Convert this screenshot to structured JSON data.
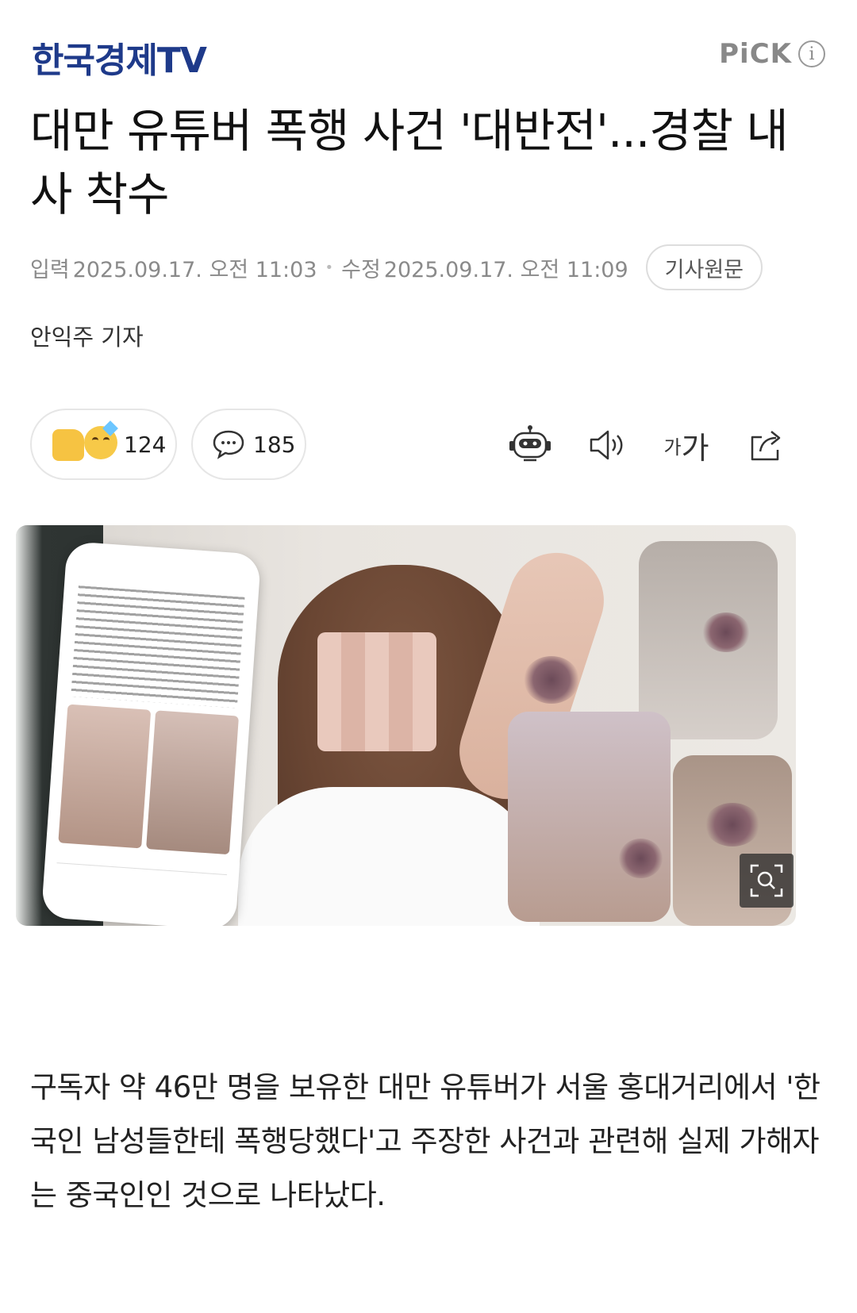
{
  "header": {
    "brand": "한국경제TV",
    "pick_label": "PiCK",
    "info_icon": "i"
  },
  "article": {
    "headline": "대만 유튜버 폭행 사건 '대반전'...경찰 내사 착수",
    "input_label": "입력",
    "input_time": "2025.09.17. 오전 11:03",
    "modified_label": "수정",
    "modified_time": "2025.09.17. 오전 11:09",
    "original_button": "기사원문",
    "reporter": "안익주 기자",
    "body": "구독자 약 46만 명을 보유한 대만 유튜버가 서울 홍대거리에서 '한국인 남성들한테 폭행당했다'고 주장한 사건과 관련해 실제 가해자는 중국인인 것으로 나타났다."
  },
  "actions": {
    "reaction_count": "124",
    "comment_count": "185",
    "font_small": "가",
    "font_big": "가",
    "icons": [
      "reaction-emoji-icon",
      "comment-bubble-icon",
      "robot-summary-icon",
      "speaker-icon",
      "font-size-icon",
      "share-icon"
    ]
  },
  "photo": {
    "zoom_icon": "zoom-search-icon"
  }
}
